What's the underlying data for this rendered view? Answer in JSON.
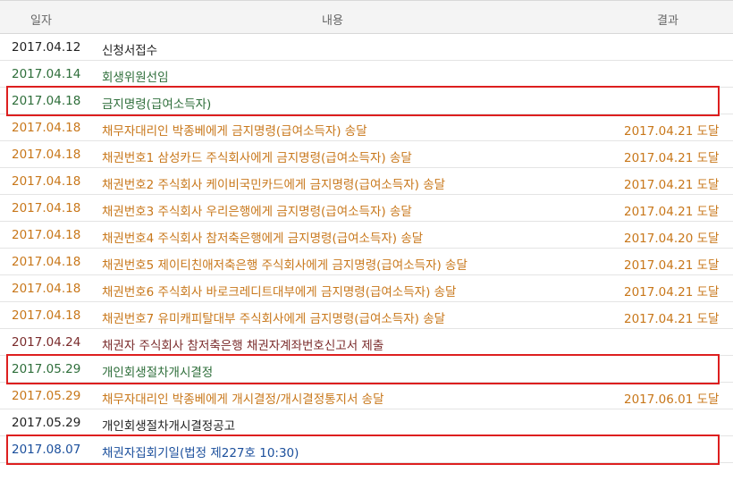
{
  "header": {
    "date": "일자",
    "content": "내용",
    "result": "결과"
  },
  "colors": {
    "black": "#222222",
    "green": "#2e6e3a",
    "orange": "#c8771a",
    "darkred": "#7a2b2b",
    "blue": "#1b4f9c",
    "highlight": "#dd1f1f"
  },
  "rows": [
    {
      "date": "2017.04.12",
      "content": "신청서접수",
      "result": "",
      "color": "#222222",
      "highlight": false
    },
    {
      "date": "2017.04.14",
      "content": "회생위원선임",
      "result": "",
      "color": "#2e6e3a",
      "highlight": false
    },
    {
      "date": "2017.04.18",
      "content": "금지명령(급여소득자)",
      "result": "",
      "color": "#2e6e3a",
      "highlight": true
    },
    {
      "date": "2017.04.18",
      "content": "채무자대리인 박종베에게 금지명령(급여소득자) 송달",
      "result": "2017.04.21 도달",
      "color": "#c8771a",
      "highlight": false
    },
    {
      "date": "2017.04.18",
      "content": "채권번호1 삼성카드 주식회사에게 금지명령(급여소득자) 송달",
      "result": "2017.04.21 도달",
      "color": "#c8771a",
      "highlight": false
    },
    {
      "date": "2017.04.18",
      "content": "채권번호2 주식회사 케이비국민카드에게 금지명령(급여소득자) 송달",
      "result": "2017.04.21 도달",
      "color": "#c8771a",
      "highlight": false
    },
    {
      "date": "2017.04.18",
      "content": "채권번호3 주식회사 우리은행에게 금지명령(급여소득자) 송달",
      "result": "2017.04.21 도달",
      "color": "#c8771a",
      "highlight": false
    },
    {
      "date": "2017.04.18",
      "content": "채권번호4 주식회사 참저축은행에게 금지명령(급여소득자) 송달",
      "result": "2017.04.20 도달",
      "color": "#c8771a",
      "highlight": false
    },
    {
      "date": "2017.04.18",
      "content": "채권번호5 제이티친애저축은행 주식회사에게 금지명령(급여소득자) 송달",
      "result": "2017.04.21 도달",
      "color": "#c8771a",
      "highlight": false
    },
    {
      "date": "2017.04.18",
      "content": "채권번호6 주식회사 바로크레디트대부에게 금지명령(급여소득자) 송달",
      "result": "2017.04.21 도달",
      "color": "#c8771a",
      "highlight": false
    },
    {
      "date": "2017.04.18",
      "content": "채권번호7 유미캐피탈대부 주식회사에게 금지명령(급여소득자) 송달",
      "result": "2017.04.21 도달",
      "color": "#c8771a",
      "highlight": false
    },
    {
      "date": "2017.04.24",
      "content": "채권자 주식회사 참저축은행 채권자계좌번호신고서 제출",
      "result": "",
      "color": "#7a2b2b",
      "highlight": false
    },
    {
      "date": "2017.05.29",
      "content": "개인회생절차개시결정",
      "result": "",
      "color": "#2e6e3a",
      "highlight": true
    },
    {
      "date": "2017.05.29",
      "content": "채무자대리인 박종베에게 개시결정/개시결정통지서 송달",
      "result": "2017.06.01 도달",
      "color": "#c8771a",
      "highlight": false
    },
    {
      "date": "2017.05.29",
      "content": "개인회생절차개시결정공고",
      "result": "",
      "color": "#222222",
      "highlight": false
    },
    {
      "date": "2017.08.07",
      "content": "채권자집회기일(법정 제227호 10:30)",
      "result": "",
      "color": "#1b4f9c",
      "highlight": true
    }
  ]
}
